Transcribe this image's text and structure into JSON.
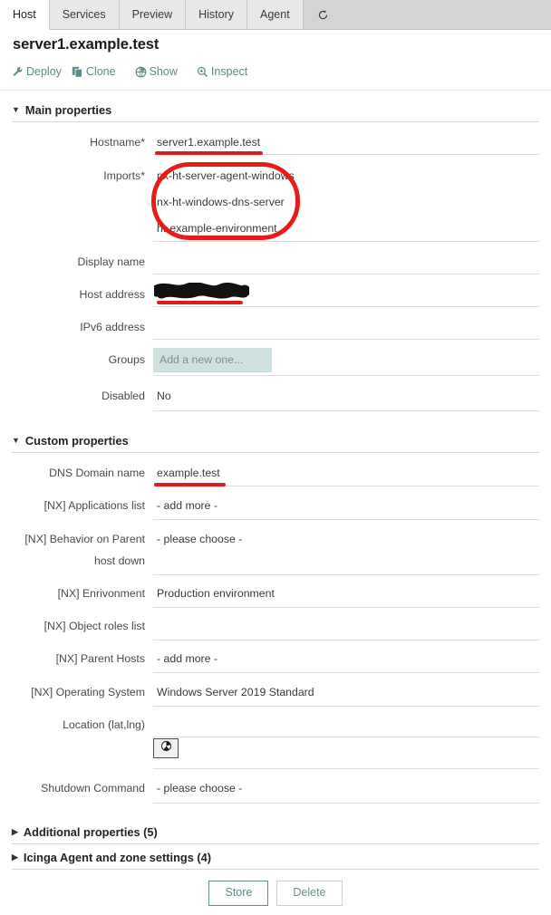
{
  "tabs": [
    {
      "label": "Host",
      "active": true
    },
    {
      "label": "Services",
      "active": false
    },
    {
      "label": "Preview",
      "active": false
    },
    {
      "label": "History",
      "active": false
    },
    {
      "label": "Agent",
      "active": false
    }
  ],
  "refresh_icon": "refresh-icon",
  "page_title": "server1.example.test",
  "toolbar": [
    {
      "label": "Deploy",
      "icon": "wrench-icon"
    },
    {
      "label": "Clone",
      "icon": "copy-icon"
    },
    {
      "label": "Show",
      "icon": "globe-icon"
    },
    {
      "label": "Inspect",
      "icon": "magnifier-plus-icon"
    }
  ],
  "sections": {
    "main": {
      "title": "Main properties",
      "expanded": true,
      "fields": [
        {
          "label": "Hostname*",
          "value": "server1.example.test"
        },
        {
          "label": "Imports*",
          "value": "nx-ht-server-agent-windows"
        },
        {
          "label": "",
          "value": "nx-ht-windows-dns-server"
        },
        {
          "label": "",
          "value": "ht-example-environment"
        },
        {
          "label": "Display name",
          "value": ""
        },
        {
          "label": "Host address",
          "value": "",
          "redacted": true
        },
        {
          "label": "IPv6 address",
          "value": ""
        },
        {
          "label": "Groups",
          "value": "",
          "placeholder": "Add a new one..."
        },
        {
          "label": "Disabled",
          "value": "No"
        }
      ]
    },
    "custom": {
      "title": "Custom properties",
      "expanded": true,
      "fields": [
        {
          "label": "DNS Domain name",
          "value": "example.test"
        },
        {
          "label": "[NX] Applications list",
          "value": "- add more -"
        },
        {
          "label": "[NX] Behavior on Parent",
          "label2": "host down",
          "value": "- please choose -"
        },
        {
          "label": "[NX] Enrivonment",
          "value": "Production environment"
        },
        {
          "label": "[NX] Object roles list",
          "value": ""
        },
        {
          "label": "[NX] Parent Hosts",
          "value": "- add more -"
        },
        {
          "label": "[NX] Operating System",
          "value": "Windows Server 2019 Standard"
        },
        {
          "label": "Location (lat,lng)",
          "value": ""
        },
        {
          "label": "",
          "value": "",
          "button_icon": "globe-picker-icon"
        },
        {
          "label": "Shutdown Command",
          "value": "- please choose -"
        }
      ]
    },
    "additional": {
      "title": "Additional properties (5)",
      "expanded": false
    },
    "icinga": {
      "title": "Icinga Agent and zone settings (4)",
      "expanded": false
    }
  },
  "buttons": {
    "store": "Store",
    "delete": "Delete"
  },
  "colors": {
    "accent": "#5c8a87",
    "annotation": "#e81b1b",
    "groups_highlight": "#cfe1df",
    "tabbar_bg": "#d4d4d4"
  }
}
